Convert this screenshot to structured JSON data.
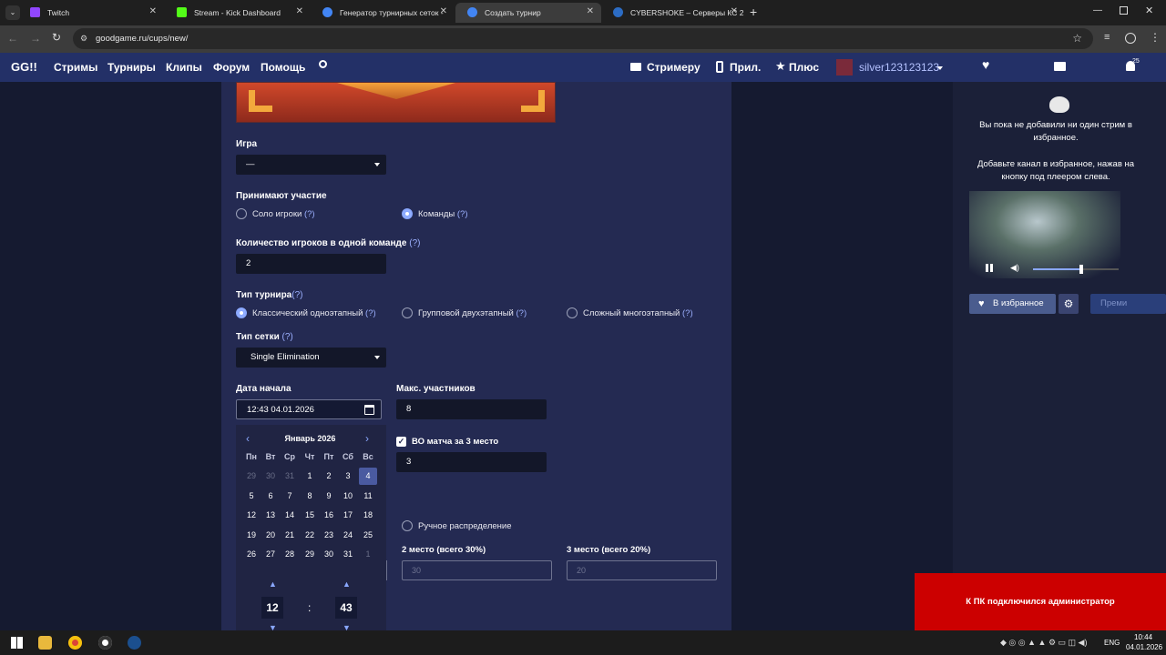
{
  "browser": {
    "tabs": [
      {
        "title": "Twitch",
        "color": "#9146ff"
      },
      {
        "title": "Stream - Kick Dashboard",
        "color": "#53fc18"
      },
      {
        "title": "Генератор турнирных сеток -",
        "color": "#4285f4"
      },
      {
        "title": "Создать турнир",
        "color": "#4285f4"
      },
      {
        "title": "CYBERSHOKE – Серверы КС 2",
        "color": "#2c6cc4"
      }
    ],
    "url": "goodgame.ru/cups/new/",
    "new_tab": "+"
  },
  "header": {
    "logo": "GG!!",
    "nav": [
      "Стримы",
      "Турниры",
      "Клипы",
      "Форум",
      "Помощь"
    ],
    "streamer": "Стримеру",
    "app": "Прил.",
    "plus": "Плюс",
    "username": "silver123123123",
    "notif_count": "25"
  },
  "form": {
    "game_label": "Игра",
    "game_value": "—",
    "participants_label": "Принимают участие",
    "solo_label": "Соло игроки",
    "teams_label": "Команды",
    "help": "(?)",
    "team_size_label": "Количество игроков в одной команде",
    "team_size_value": "2",
    "tourney_type_label": "Тип турнира",
    "type_classic": "Классический одноэтапный",
    "type_group": "Групповой двухэтапный",
    "type_complex": "Сложный многоэтапный",
    "bracket_label": "Тип сетки",
    "bracket_value": "Single Elimination",
    "start_date_label": "Дата начала",
    "start_date_value": "12:43 04.01.2026",
    "max_label": "Макс. участников",
    "max_value": "8",
    "bo3_label": "ВО матча за 3 место",
    "bo3_value": "3",
    "manual_label": "Ручное распределение",
    "place2_label": "2 место (всего 30%)",
    "place2_value": "30",
    "place3_label": "3 место (всего 20%)",
    "place3_value": "20"
  },
  "calendar": {
    "month": "Январь 2026",
    "weekdays": [
      "Пн",
      "Вт",
      "Ср",
      "Чт",
      "Пт",
      "Сб",
      "Вс"
    ],
    "weeks": [
      [
        "29",
        "30",
        "31",
        "1",
        "2",
        "3",
        "4"
      ],
      [
        "5",
        "6",
        "7",
        "8",
        "9",
        "10",
        "11"
      ],
      [
        "12",
        "13",
        "14",
        "15",
        "16",
        "17",
        "18"
      ],
      [
        "19",
        "20",
        "21",
        "22",
        "23",
        "24",
        "25"
      ],
      [
        "26",
        "27",
        "28",
        "29",
        "30",
        "31",
        "1"
      ]
    ],
    "hour": "12",
    "minute": "43",
    "sep": ":"
  },
  "sidebar": {
    "empty1": "Вы пока не добавили ни один стрим в избранное.",
    "empty2": "Добавьте канал в избранное, нажав на кнопку под плеером слева.",
    "fav_button": "В избранное",
    "premium_button": "Преми"
  },
  "notification": "К ПК подключился администратор",
  "taskbar": {
    "lang": "ENG",
    "time": "10:44",
    "date": "04.01.2026"
  }
}
